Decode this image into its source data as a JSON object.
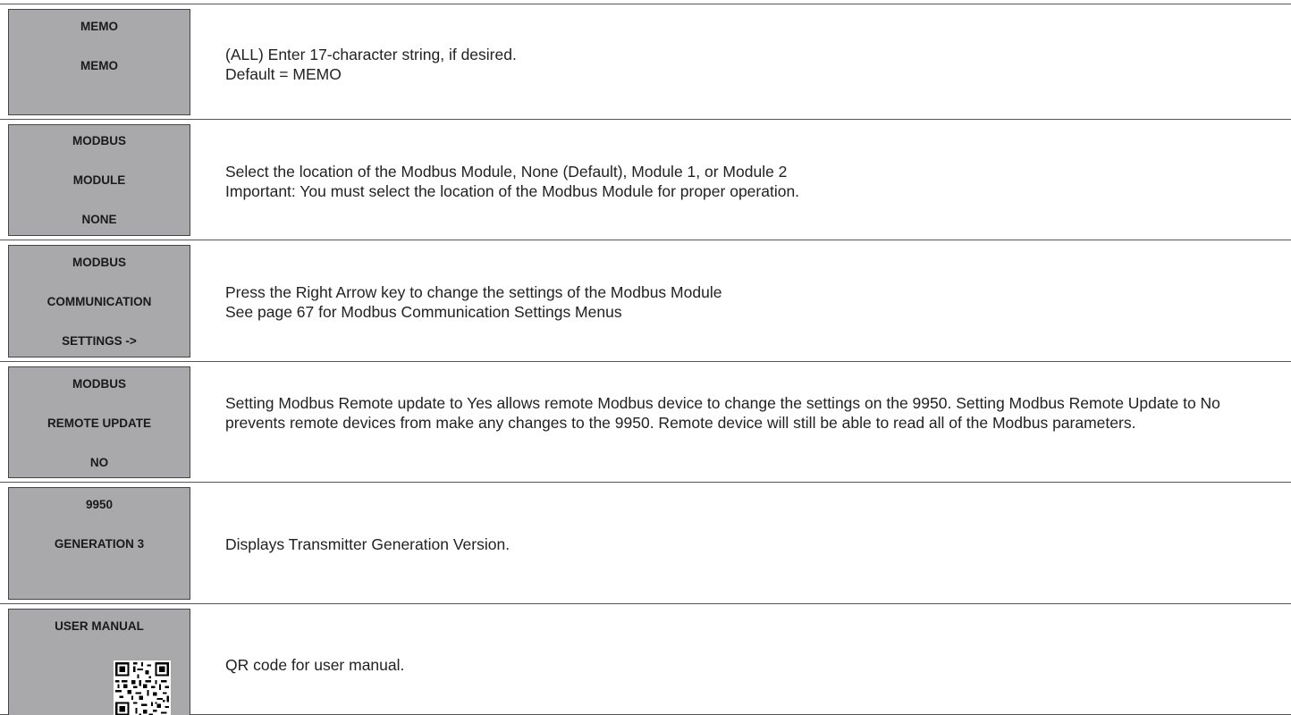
{
  "rows": [
    {
      "screen": [
        "MEMO",
        "MEMO"
      ],
      "description": [
        "(ALL) Enter 17-character string, if desired.",
        "Default = MEMO"
      ]
    },
    {
      "screen": [
        "MODBUS",
        "MODULE",
        "NONE"
      ],
      "description": [
        "Select the location of the Modbus Module, None (Default), Module 1, or Module 2",
        "Important: You must select the location of the Modbus Module for proper operation."
      ]
    },
    {
      "screen": [
        "MODBUS",
        "COMMUNICATION",
        "SETTINGS ->"
      ],
      "description": [
        "Press the Right Arrow key to change the settings of the Modbus Module",
        "See page 67 for Modbus Communication Settings Menus"
      ]
    },
    {
      "screen": [
        "MODBUS",
        "REMOTE UPDATE",
        "NO"
      ],
      "description": [
        "Setting Modbus Remote update to Yes allows remote Modbus device to change the settings on the 9950. Setting Modbus Remote Update to No prevents remote devices from make any changes to the 9950. Remote device will still be able to read all of the Modbus parameters."
      ]
    },
    {
      "screen": [
        "9950",
        "GENERATION 3"
      ],
      "description": [
        "Displays Transmitter Generation Version."
      ]
    },
    {
      "screen": [
        "USER MANUAL"
      ],
      "description": [
        "QR code for user manual."
      ],
      "qr": "qr-code-icon"
    }
  ],
  "colors": {
    "screen_bg": "#a9a9ab",
    "rule": "#555555",
    "text": "#222222"
  }
}
